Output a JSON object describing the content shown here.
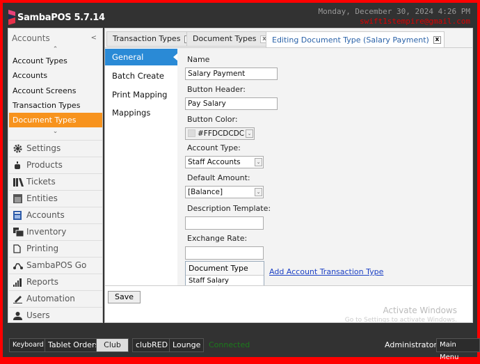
{
  "app": {
    "title": "SambaPOS 5.7.14",
    "datetime": "Monday, December 30, 2024 4:26 PM",
    "email": "swift1stempire@gmail.com",
    "accent": "#f7931e",
    "selection_blue": "#2a8ad6"
  },
  "left": {
    "header": "Accounts",
    "collapse": "<",
    "sub_items": [
      {
        "label": "Account Types"
      },
      {
        "label": "Accounts"
      },
      {
        "label": "Account Screens"
      },
      {
        "label": "Transaction Types"
      },
      {
        "label": "Document Types",
        "selected": true
      }
    ],
    "modules": [
      {
        "label": "Settings",
        "icon": "gear-icon"
      },
      {
        "label": "Products",
        "icon": "cup-icon"
      },
      {
        "label": "Tickets",
        "icon": "tickets-icon"
      },
      {
        "label": "Entities",
        "icon": "entities-icon"
      },
      {
        "label": "Accounts",
        "icon": "calculator-icon"
      },
      {
        "label": "Inventory",
        "icon": "inventory-icon"
      },
      {
        "label": "Printing",
        "icon": "document-icon"
      },
      {
        "label": "SambaPOS Go",
        "icon": "scooter-icon"
      },
      {
        "label": "Reports",
        "icon": "bar-chart-icon"
      },
      {
        "label": "Automation",
        "icon": "pen-icon"
      },
      {
        "label": "Users",
        "icon": "user-icon"
      }
    ]
  },
  "tabs": [
    {
      "label": "Transaction Types"
    },
    {
      "label": "Document Types"
    },
    {
      "label": "Editing Document Type (Salary Payment)",
      "active": true
    }
  ],
  "close_glyph": "x",
  "nav": [
    {
      "label": "General Settings",
      "selected": true
    },
    {
      "label": "Batch Create"
    },
    {
      "label": "Print Mapping"
    },
    {
      "label": "Mappings"
    }
  ],
  "form": {
    "name_label": "Name",
    "name_value": "Salary Payment",
    "header_label": "Button Header:",
    "header_value": "Pay Salary",
    "color_label": "Button Color:",
    "color_value": "#FFDCDCDC",
    "account_type_label": "Account Type:",
    "account_type_value": "Staff Accounts",
    "default_amount_label": "Default Amount:",
    "default_amount_value": "[Balance]",
    "description_label": "Description Template:",
    "description_value": "",
    "exchange_label": "Exchange Rate:",
    "exchange_value": "",
    "list_header": "Document Type",
    "list_row": "Staff Salary Transaction",
    "add_link": "Add Account Transaction Type"
  },
  "save_label": "Save",
  "watermark": {
    "line1": "Activate Windows",
    "line2": "Go to Settings to activate Windows."
  },
  "footer": {
    "buttons": [
      {
        "label": "Keyboard"
      },
      {
        "label": "Tablet Orders"
      },
      {
        "label": "Club",
        "active": true
      },
      {
        "label": "clubRED"
      },
      {
        "label": "Lounge"
      }
    ],
    "status": "Connected",
    "user": "Administrator",
    "main_menu": "Main Menu"
  }
}
